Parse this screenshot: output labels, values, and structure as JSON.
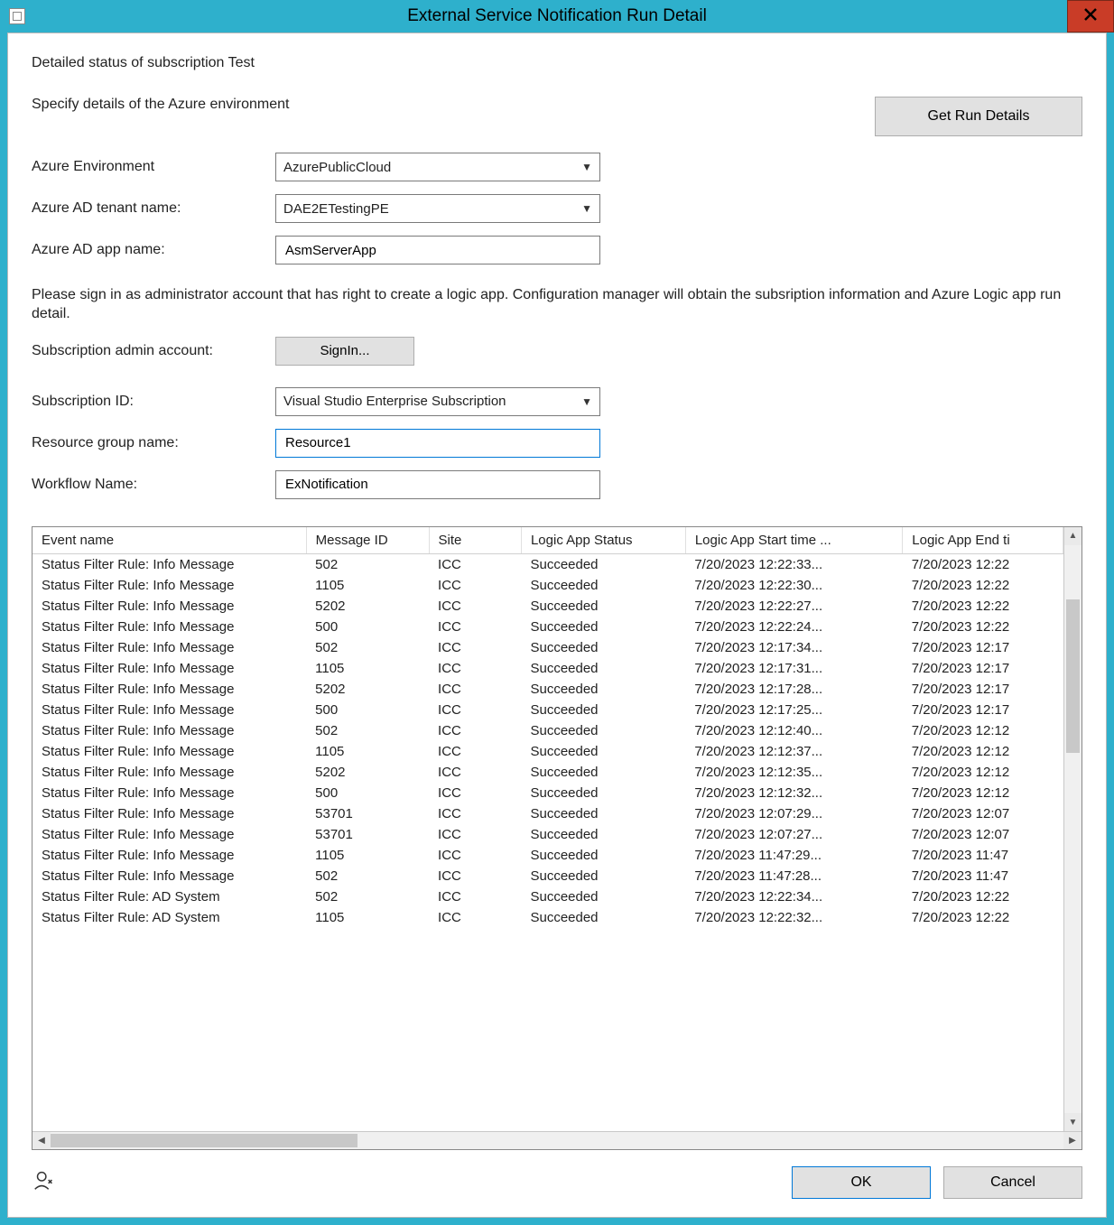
{
  "window": {
    "title": "External Service Notification Run Detail",
    "close_tooltip": "Close"
  },
  "header": {
    "status_text": "Detailed status of subscription Test",
    "env_instruction": "Specify details of the Azure environment",
    "get_run_details_label": "Get Run Details"
  },
  "fields": {
    "azure_env_label": "Azure Environment",
    "azure_env_value": "AzurePublicCloud",
    "tenant_label": "Azure AD tenant name:",
    "tenant_value": "DAE2ETestingPE",
    "app_label": "Azure AD app name:",
    "app_value": "AsmServerApp",
    "signin_info": "Please sign in as administrator account that has right to create a logic app. Configuration manager will obtain the subsription information and Azure Logic app run detail.",
    "subscription_admin_label": "Subscription admin account:",
    "signin_button": "SignIn...",
    "subscription_id_label": "Subscription ID:",
    "subscription_id_value": "Visual Studio Enterprise Subscription",
    "resource_group_label": "Resource group name:",
    "resource_group_value": "Resource1",
    "workflow_label": "Workflow Name:",
    "workflow_value": "ExNotification"
  },
  "table": {
    "headers": {
      "event_name": "Event name",
      "message_id": "Message ID",
      "site": "Site",
      "status": "Logic App Status",
      "start": "Logic App Start time ...",
      "end": "Logic App End ti"
    },
    "rows": [
      {
        "event": "Status Filter Rule: Info Message",
        "msg": "502",
        "site": "ICC",
        "status": "Succeeded",
        "start": "7/20/2023 12:22:33...",
        "end": "7/20/2023 12:22"
      },
      {
        "event": "Status Filter Rule: Info Message",
        "msg": "1105",
        "site": "ICC",
        "status": "Succeeded",
        "start": "7/20/2023 12:22:30...",
        "end": "7/20/2023 12:22"
      },
      {
        "event": "Status Filter Rule: Info Message",
        "msg": "5202",
        "site": "ICC",
        "status": "Succeeded",
        "start": "7/20/2023 12:22:27...",
        "end": "7/20/2023 12:22"
      },
      {
        "event": "Status Filter Rule: Info Message",
        "msg": "500",
        "site": "ICC",
        "status": "Succeeded",
        "start": "7/20/2023 12:22:24...",
        "end": "7/20/2023 12:22"
      },
      {
        "event": "Status Filter Rule: Info Message",
        "msg": "502",
        "site": "ICC",
        "status": "Succeeded",
        "start": "7/20/2023 12:17:34...",
        "end": "7/20/2023 12:17"
      },
      {
        "event": "Status Filter Rule: Info Message",
        "msg": "1105",
        "site": "ICC",
        "status": "Succeeded",
        "start": "7/20/2023 12:17:31...",
        "end": "7/20/2023 12:17"
      },
      {
        "event": "Status Filter Rule: Info Message",
        "msg": "5202",
        "site": "ICC",
        "status": "Succeeded",
        "start": "7/20/2023 12:17:28...",
        "end": "7/20/2023 12:17"
      },
      {
        "event": "Status Filter Rule: Info Message",
        "msg": "500",
        "site": "ICC",
        "status": "Succeeded",
        "start": "7/20/2023 12:17:25...",
        "end": "7/20/2023 12:17"
      },
      {
        "event": "Status Filter Rule: Info Message",
        "msg": "502",
        "site": "ICC",
        "status": "Succeeded",
        "start": "7/20/2023 12:12:40...",
        "end": "7/20/2023 12:12"
      },
      {
        "event": "Status Filter Rule: Info Message",
        "msg": "1105",
        "site": "ICC",
        "status": "Succeeded",
        "start": "7/20/2023 12:12:37...",
        "end": "7/20/2023 12:12"
      },
      {
        "event": "Status Filter Rule: Info Message",
        "msg": "5202",
        "site": "ICC",
        "status": "Succeeded",
        "start": "7/20/2023 12:12:35...",
        "end": "7/20/2023 12:12"
      },
      {
        "event": "Status Filter Rule: Info Message",
        "msg": "500",
        "site": "ICC",
        "status": "Succeeded",
        "start": "7/20/2023 12:12:32...",
        "end": "7/20/2023 12:12"
      },
      {
        "event": "Status Filter Rule: Info Message",
        "msg": "53701",
        "site": "ICC",
        "status": "Succeeded",
        "start": "7/20/2023 12:07:29...",
        "end": "7/20/2023 12:07"
      },
      {
        "event": "Status Filter Rule: Info Message",
        "msg": "53701",
        "site": "ICC",
        "status": "Succeeded",
        "start": "7/20/2023 12:07:27...",
        "end": "7/20/2023 12:07"
      },
      {
        "event": "Status Filter Rule: Info Message",
        "msg": "1105",
        "site": "ICC",
        "status": "Succeeded",
        "start": "7/20/2023 11:47:29...",
        "end": "7/20/2023 11:47"
      },
      {
        "event": "Status Filter Rule: Info Message",
        "msg": "502",
        "site": "ICC",
        "status": "Succeeded",
        "start": "7/20/2023 11:47:28...",
        "end": "7/20/2023 11:47"
      },
      {
        "event": "Status Filter Rule: AD System",
        "msg": "502",
        "site": "ICC",
        "status": "Succeeded",
        "start": "7/20/2023 12:22:34...",
        "end": "7/20/2023 12:22"
      },
      {
        "event": "Status Filter Rule: AD System",
        "msg": "1105",
        "site": "ICC",
        "status": "Succeeded",
        "start": "7/20/2023 12:22:32...",
        "end": "7/20/2023 12:22"
      }
    ]
  },
  "footer": {
    "ok_label": "OK",
    "cancel_label": "Cancel"
  }
}
